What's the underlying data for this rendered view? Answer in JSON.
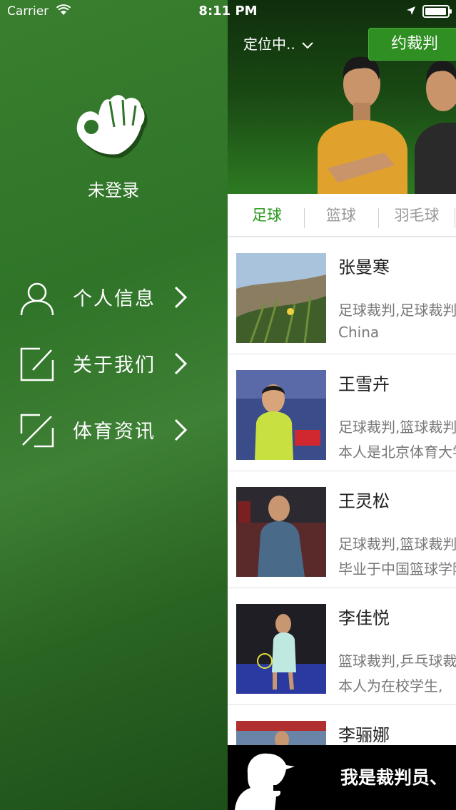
{
  "status_bar": {
    "carrier": "Carrier",
    "time": "8:11 PM",
    "battery_level": 0.9
  },
  "drawer": {
    "user_status": "未登录",
    "menu": [
      {
        "label": "个人信息",
        "icon": "user-icon"
      },
      {
        "label": "关于我们",
        "icon": "edit-square-icon"
      },
      {
        "label": "体育资讯",
        "icon": "news-icon"
      }
    ]
  },
  "header": {
    "location": "定位中..",
    "book_button": "约裁判"
  },
  "tabs": [
    {
      "label": "足球",
      "active": true
    },
    {
      "label": "篮球",
      "active": false
    },
    {
      "label": "羽毛球",
      "active": false
    }
  ],
  "referees": [
    {
      "name": "张曼寒",
      "tags": "足球裁判,足球裁判",
      "bio": "China"
    },
    {
      "name": "王雪卉",
      "tags": "足球裁判,篮球裁判",
      "bio": "本人是北京体育大学"
    },
    {
      "name": "王灵松",
      "tags": "足球裁判,篮球裁判",
      "bio": "毕业于中国篮球学院"
    },
    {
      "name": "李佳悦",
      "tags": "篮球裁判,乒乓球裁判",
      "bio": "本人为在校学生,"
    },
    {
      "name": "李骊娜",
      "tags": "",
      "bio": ""
    }
  ],
  "promo": {
    "text": "我是裁判员、"
  },
  "colors": {
    "accent_green": "#2a9a1c",
    "drawer_green": "#2f7428",
    "button_green": "#2f8f22"
  }
}
